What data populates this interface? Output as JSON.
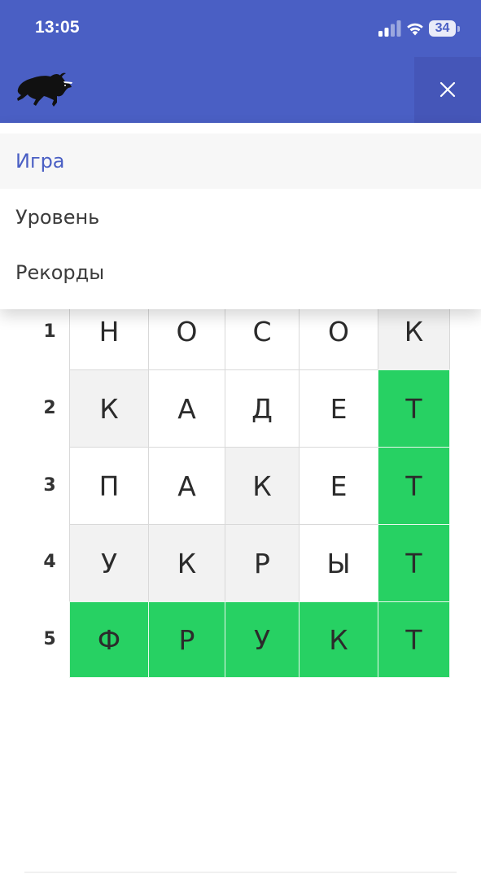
{
  "status_bar": {
    "time": "13:05",
    "battery": "34",
    "icons": [
      "signal-icon",
      "wifi-icon",
      "battery-icon"
    ]
  },
  "header": {
    "logo_icon": "bull-logo-icon",
    "close_icon": "close-icon",
    "background_color": "#4a5fc4"
  },
  "menu": {
    "items": [
      {
        "label": "Игра",
        "active": true
      },
      {
        "label": "Уровень",
        "active": false
      },
      {
        "label": "Рекорды",
        "active": false
      }
    ],
    "active_color": "#4a5fc4"
  },
  "grid": {
    "rows": [
      {
        "number": "1",
        "letters": [
          "Н",
          "О",
          "С",
          "О",
          "К"
        ],
        "states": [
          "empty",
          "empty",
          "empty",
          "empty",
          "gray"
        ]
      },
      {
        "number": "2",
        "letters": [
          "К",
          "А",
          "Д",
          "Е",
          "Т"
        ],
        "states": [
          "gray",
          "empty",
          "empty",
          "empty",
          "green"
        ]
      },
      {
        "number": "3",
        "letters": [
          "П",
          "А",
          "К",
          "Е",
          "Т"
        ],
        "states": [
          "empty",
          "empty",
          "gray",
          "empty",
          "green"
        ]
      },
      {
        "number": "4",
        "letters": [
          "У",
          "К",
          "Р",
          "Ы",
          "Т"
        ],
        "states": [
          "gray",
          "gray",
          "gray",
          "empty",
          "green"
        ]
      },
      {
        "number": "5",
        "letters": [
          "Ф",
          "Р",
          "У",
          "К",
          "Т"
        ],
        "states": [
          "green",
          "green",
          "green",
          "green",
          "green"
        ]
      }
    ],
    "colors": {
      "green": "#27d163",
      "gray": "#f2f2f2",
      "empty": "#ffffff"
    }
  }
}
